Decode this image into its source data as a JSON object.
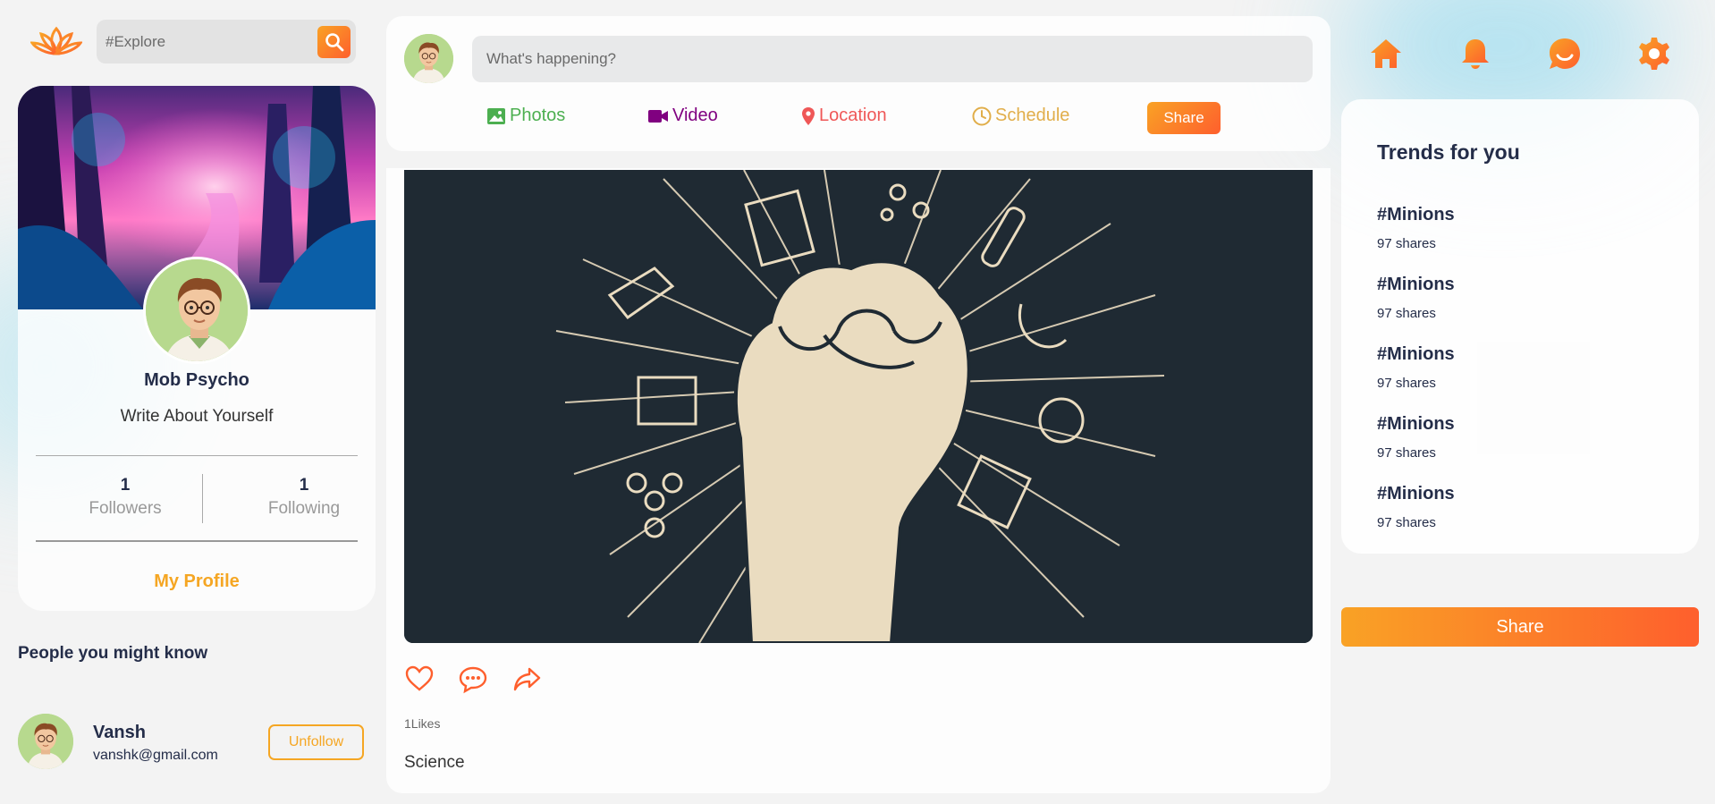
{
  "search": {
    "placeholder": "#Explore"
  },
  "profile": {
    "name": "Mob Psycho",
    "about": "Write About Yourself",
    "followers_count": "1",
    "followers_label": "Followers",
    "following_count": "1",
    "following_label": "Following",
    "link_label": "My Profile"
  },
  "people": {
    "title": "People you might know",
    "items": [
      {
        "name": "Vansh",
        "email": "vanshk@gmail.com",
        "button": "Unfollow"
      }
    ]
  },
  "composer": {
    "placeholder": "What's happening?",
    "options": [
      {
        "label": "Photos",
        "icon": "photo-icon",
        "color": "#4caf50"
      },
      {
        "label": "Video",
        "icon": "video-icon",
        "color": "#800080"
      },
      {
        "label": "Location",
        "icon": "location-pin-icon",
        "color": "#ef5757"
      },
      {
        "label": "Schedule",
        "icon": "clock-icon",
        "color": "#e1ae4a"
      }
    ],
    "share_label": "Share"
  },
  "post": {
    "likes": "1Likes",
    "description": "Science"
  },
  "nav": {
    "icons": [
      "home-icon",
      "bell-icon",
      "chat-icon",
      "gear-icon"
    ]
  },
  "trends": {
    "title": "Trends for you",
    "items": [
      {
        "tag": "#Minions",
        "shares": "97 shares"
      },
      {
        "tag": "#Minions",
        "shares": "97 shares"
      },
      {
        "tag": "#Minions",
        "shares": "97 shares"
      },
      {
        "tag": "#Minions",
        "shares": "97 shares"
      },
      {
        "tag": "#Minions",
        "shares": "97 shares"
      }
    ]
  },
  "share_button": "Share",
  "colors": {
    "accent": "#f5a623",
    "orange": "#fe5f2d",
    "text": "#242d49"
  }
}
